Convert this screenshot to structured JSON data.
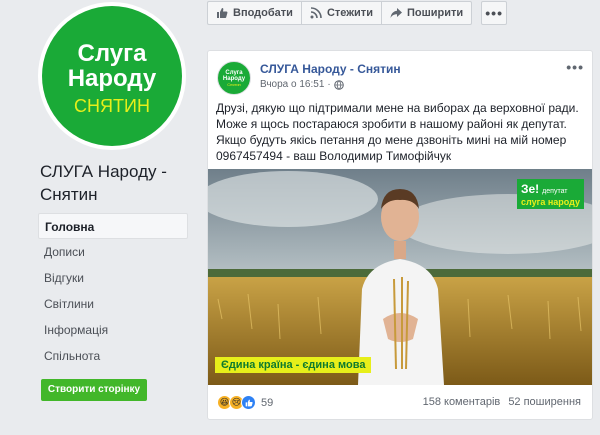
{
  "page": {
    "avatar": {
      "line1": "Слуга",
      "line2": "Народу",
      "line3": "СНЯТИН"
    },
    "name": "СЛУГА Народу - Снятин"
  },
  "nav": [
    {
      "label": "Головна",
      "active": true
    },
    {
      "label": "Дописи",
      "active": false
    },
    {
      "label": "Відгуки",
      "active": false
    },
    {
      "label": "Світлини",
      "active": false
    },
    {
      "label": "Інформація",
      "active": false
    },
    {
      "label": "Спільнота",
      "active": false
    }
  ],
  "create_button": "Створити сторінку",
  "actions": {
    "like": "Вподобати",
    "follow": "Стежити",
    "share": "Поширити",
    "more": "•••"
  },
  "post": {
    "avatar": {
      "line1": "Слуга",
      "line2": "Народу",
      "line3": "Снятин"
    },
    "author": "СЛУГА Народу - Снятин",
    "time": "Вчора о 16:51",
    "separator": "·",
    "menu": "•••",
    "text": "Друзі, дякую що підтримали мене на виборах да верховної ради. Може я щось постараюся зробити в нашому районі як депутат. Якщо будуть якісь петання до мене дзвоніть мині на мій номер 0967457494 - ваш Володимир Тимофійчук",
    "image": {
      "badge_ze": "Зе!",
      "badge_deputy": "депутат",
      "badge_party": "слуга народу",
      "slogan": "Єдина країна - єдина мова"
    },
    "reactions_count": "59",
    "comments": "158 коментарів",
    "shares": "52 поширення"
  },
  "colors": {
    "brand_green": "#1aaa37",
    "brand_yellow": "#e7ef1a",
    "fb_link": "#365899",
    "cta_green": "#42b72a"
  }
}
